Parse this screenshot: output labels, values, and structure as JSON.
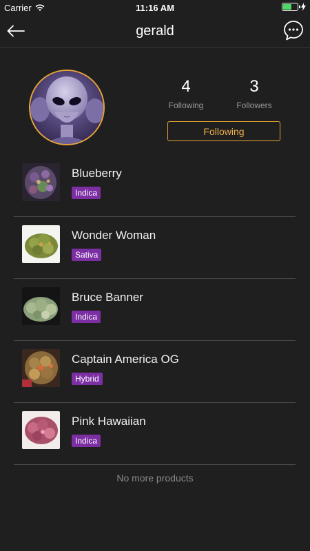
{
  "status": {
    "carrier": "Carrier",
    "time": "11:16 AM",
    "battery_percent": 60
  },
  "nav": {
    "title": "gerald",
    "back_icon": "back-arrow-icon",
    "chat_icon": "chat-bubble-icon"
  },
  "profile": {
    "following_count": "4",
    "following_label": "Following",
    "followers_count": "3",
    "followers_label": "Followers",
    "follow_button_label": "Following"
  },
  "products": [
    {
      "name": "Blueberry",
      "type": "Indica"
    },
    {
      "name": "Wonder Woman",
      "type": "Sativa"
    },
    {
      "name": "Bruce Banner",
      "type": "Indica"
    },
    {
      "name": "Captain America OG",
      "type": "Hybrid"
    },
    {
      "name": "Pink Hawaiian",
      "type": "Indica"
    }
  ],
  "footer": {
    "no_more_label": "No more products"
  },
  "colors": {
    "background": "#1f1f1f",
    "accent": "#e8a43a",
    "badge": "#7b2fa3"
  }
}
